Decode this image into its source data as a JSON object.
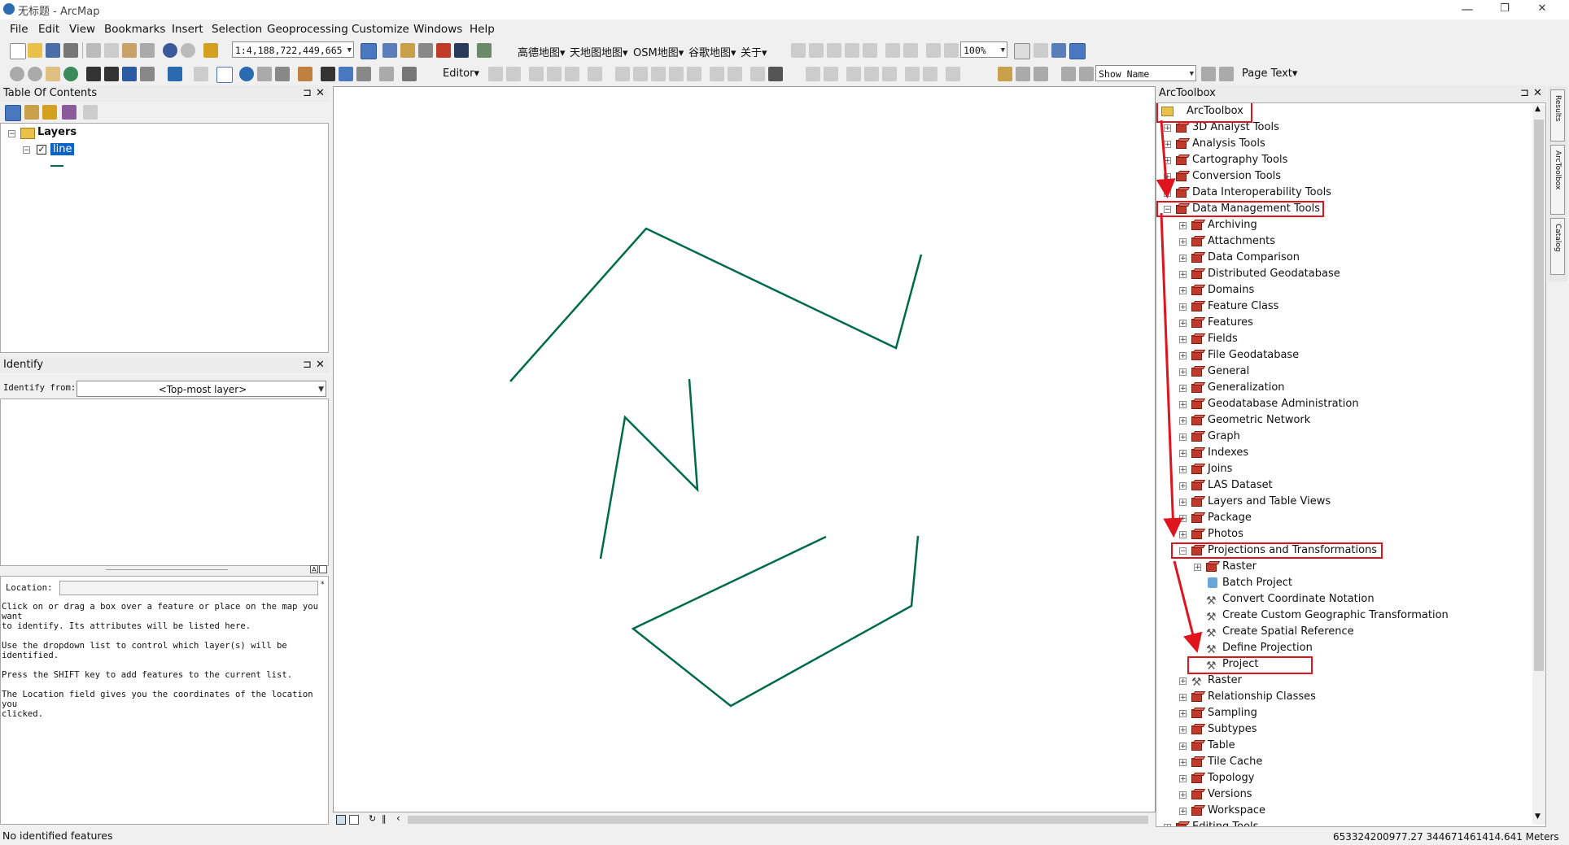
{
  "window": {
    "title": "无标题 - ArcMap",
    "minimize": "—",
    "maximize": "❐",
    "close": "✕"
  },
  "menu": [
    "File",
    "Edit",
    "View",
    "Bookmarks",
    "Insert",
    "Selection",
    "Geoprocessing",
    "Customize",
    "Windows",
    "Help"
  ],
  "toolbar1": {
    "scale": "1:4,188,722,449,665",
    "basemaps": [
      "高德地图▾",
      "天地图地图▾",
      "OSM地图▾",
      "谷歌地图▾",
      "关于▾"
    ],
    "zoom_percent": "100%"
  },
  "toolbar2": {
    "editor": "Editor▾",
    "show_name": "Show Name",
    "page_text": "Page Text▾"
  },
  "toc": {
    "title": "Table Of Contents",
    "layers_label": "Layers",
    "layer_name": "line",
    "line_color": "#006b4a"
  },
  "identify": {
    "title": "Identify",
    "from_label": "Identify from:",
    "from_value": "<Top-most layer>",
    "location_label": "Location:",
    "help": [
      "Click on or drag a box over a feature or place on the map you want",
      "to identify. Its attributes will be listed here.",
      "",
      "Use the dropdown list to control which layer(s) will be",
      "identified.",
      "",
      "Press the SHIFT key to add features to the current list.",
      "",
      "The Location field gives you the coordinates of the location you",
      "clicked."
    ]
  },
  "toolbox": {
    "title": "ArcToolbox",
    "root": "ArcToolbox",
    "items": [
      "3D Analyst Tools",
      "Analysis Tools",
      "Cartography Tools",
      "Conversion Tools",
      "Data Interoperability Tools",
      "Data Management Tools"
    ],
    "dm_children": [
      "Archiving",
      "Attachments",
      "Data Comparison",
      "Distributed Geodatabase",
      "Domains",
      "Feature Class",
      "Features",
      "Fields",
      "File Geodatabase",
      "General",
      "Generalization",
      "Geodatabase Administration",
      "Geometric Network",
      "Graph",
      "Indexes",
      "Joins",
      "LAS Dataset",
      "Layers and Table Views",
      "Package",
      "Photos",
      "Projections and Transformations"
    ],
    "pt_children": [
      "Raster",
      "Batch Project",
      "Convert Coordinate Notation",
      "Create Custom Geographic Transformation",
      "Create Spatial Reference",
      "Define Projection",
      "Project"
    ],
    "dm_after": [
      "Raster",
      "Relationship Classes",
      "Sampling",
      "Subtypes",
      "Table",
      "Tile Cache",
      "Topology",
      "Versions",
      "Workspace"
    ],
    "last_partial": "Editing Tools",
    "side_tabs": [
      "Results",
      "ArcToolbox",
      "Catalog"
    ]
  },
  "status": {
    "left": "No identified features",
    "coords": "653324200977.27  344671461414.641 Meters"
  },
  "colors": {
    "highlight": "#e0141e",
    "arrow": "#e0141e",
    "selection": "#0a64c8"
  }
}
